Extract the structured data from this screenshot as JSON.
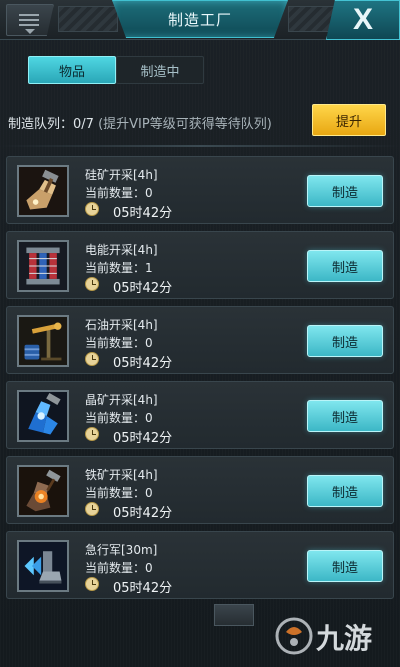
{
  "header": {
    "title": "制造工厂",
    "close_label": "X",
    "menu_icon": "menu-icon"
  },
  "tabs": [
    {
      "label": "物品",
      "active": true
    },
    {
      "label": "制造中",
      "active": false
    }
  ],
  "queue": {
    "label": "制造队列：",
    "count": "0/7",
    "note": "(提升VIP等级可获得等待队列)",
    "upgrade_label": "提升"
  },
  "items": [
    {
      "name": "硅矿开采[4h]",
      "qty": "当前数量：0",
      "time": "05时42分",
      "button": "制造",
      "icon": "silicon-ore-icon"
    },
    {
      "name": "电能开采[4h]",
      "qty": "当前数量：1",
      "time": "05时42分",
      "button": "制造",
      "icon": "electric-coil-icon"
    },
    {
      "name": "石油开采[4h]",
      "qty": "当前数量：0",
      "time": "05时42分",
      "button": "制造",
      "icon": "oil-pump-icon"
    },
    {
      "name": "晶矿开采[4h]",
      "qty": "当前数量：0",
      "time": "05时42分",
      "button": "制造",
      "icon": "crystal-ore-icon"
    },
    {
      "name": "铁矿开采[4h]",
      "qty": "当前数量：0",
      "time": "05时42分",
      "button": "制造",
      "icon": "iron-ore-icon"
    },
    {
      "name": "急行军[30m]",
      "qty": "当前数量：0",
      "time": "05时42分",
      "button": "制造",
      "icon": "speed-boots-icon"
    }
  ],
  "watermark": {
    "text": "九游"
  },
  "colors": {
    "accent": "#3cb7c6",
    "upgrade": "#e8a712",
    "background": "#15191d"
  }
}
